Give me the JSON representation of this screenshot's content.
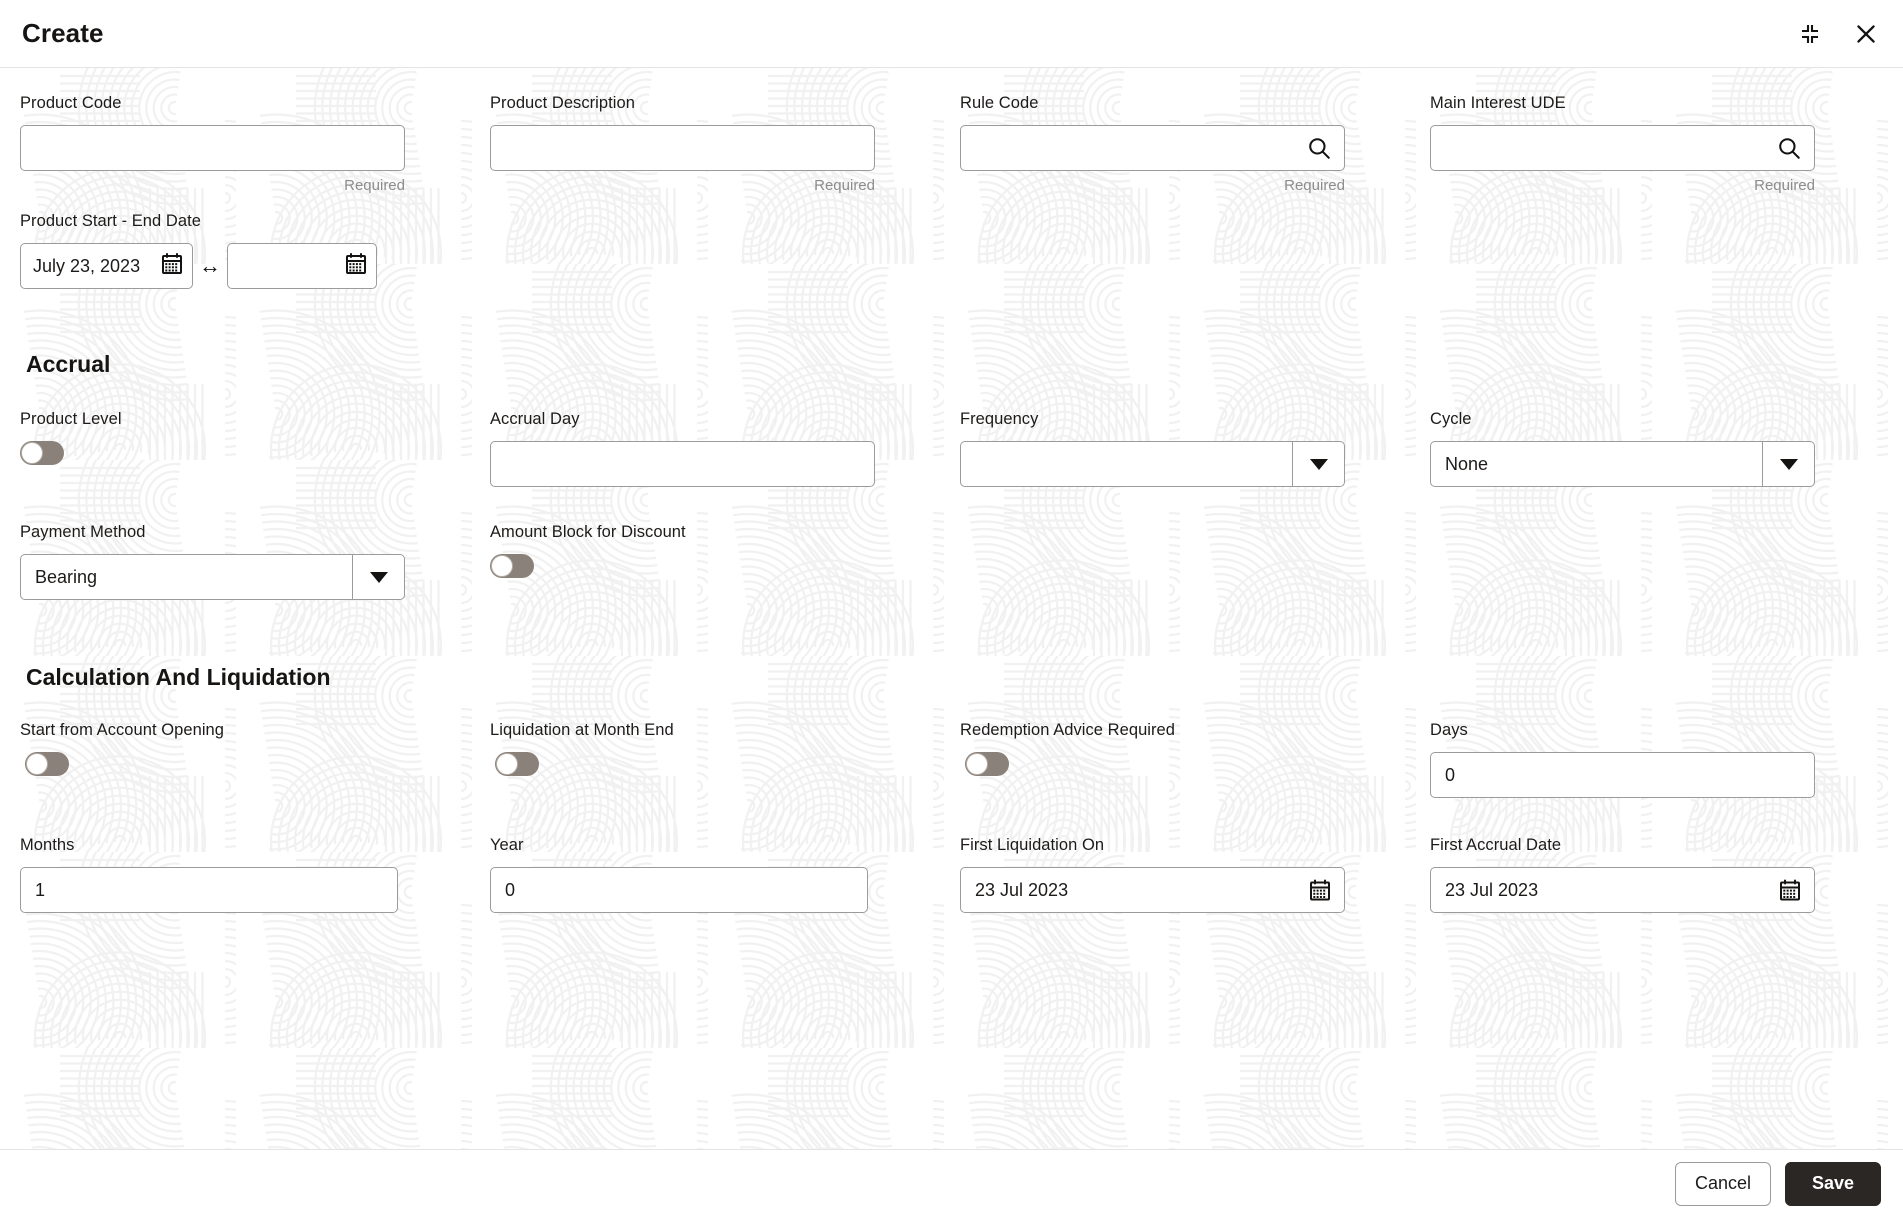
{
  "window": {
    "title": "Create",
    "minimize_icon": "collapse-icon",
    "close_icon": "close-icon"
  },
  "form": {
    "row1": [
      {
        "label": "Product Code",
        "value": "",
        "helper": "Required",
        "type": "text",
        "icon": ""
      },
      {
        "label": "Product Description",
        "value": "",
        "helper": "Required",
        "type": "text",
        "icon": ""
      },
      {
        "label": "Rule Code",
        "value": "",
        "helper": "Required",
        "type": "search",
        "icon": "search-icon"
      },
      {
        "label": "Main Interest UDE",
        "value": "",
        "helper": "Required",
        "type": "search",
        "icon": "search-icon"
      }
    ],
    "date_range": {
      "label": "Product Start - End Date",
      "start_value": "July 23, 2023",
      "end_value": "",
      "separator": "↔",
      "calendar_icon": "calendar-icon"
    }
  },
  "accrual": {
    "heading": "Accrual",
    "product_level": {
      "label": "Product Level",
      "state": "off"
    },
    "accrual_day": {
      "label": "Accrual Day",
      "value": ""
    },
    "frequency": {
      "label": "Frequency",
      "value": "",
      "caret": "chevron-down-icon"
    },
    "cycle": {
      "label": "Cycle",
      "value": "None",
      "caret": "chevron-down-icon"
    },
    "payment_method": {
      "label": "Payment Method",
      "value": "Bearing",
      "caret": "chevron-down-icon"
    },
    "amount_block": {
      "label": "Amount Block for Discount",
      "state": "off"
    }
  },
  "calculation": {
    "heading": "Calculation And Liquidation",
    "start_from_account_opening": {
      "label": "Start from Account Opening",
      "state": "off"
    },
    "liquidation_at_month_end": {
      "label": "Liquidation at Month End",
      "state": "off"
    },
    "redemption_advice_required": {
      "label": "Redemption Advice Required",
      "state": "off"
    },
    "days": {
      "label": "Days",
      "value": "0"
    },
    "months": {
      "label": "Months",
      "value": "1"
    },
    "year": {
      "label": "Year",
      "value": "0"
    },
    "first_liquidation_on": {
      "label": "First Liquidation On",
      "value": "23 Jul 2023",
      "icon": "calendar-icon"
    },
    "first_accrual_date": {
      "label": "First Accrual Date",
      "value": "23 Jul 2023",
      "icon": "calendar-icon"
    }
  },
  "footer": {
    "cancel_label": "Cancel",
    "save_label": "Save"
  },
  "colors": {
    "save_button_bg": "#2b2724",
    "border": "#9b9b9b",
    "toggle_track": "#8a827a",
    "helper_text": "#8c8c8c"
  }
}
